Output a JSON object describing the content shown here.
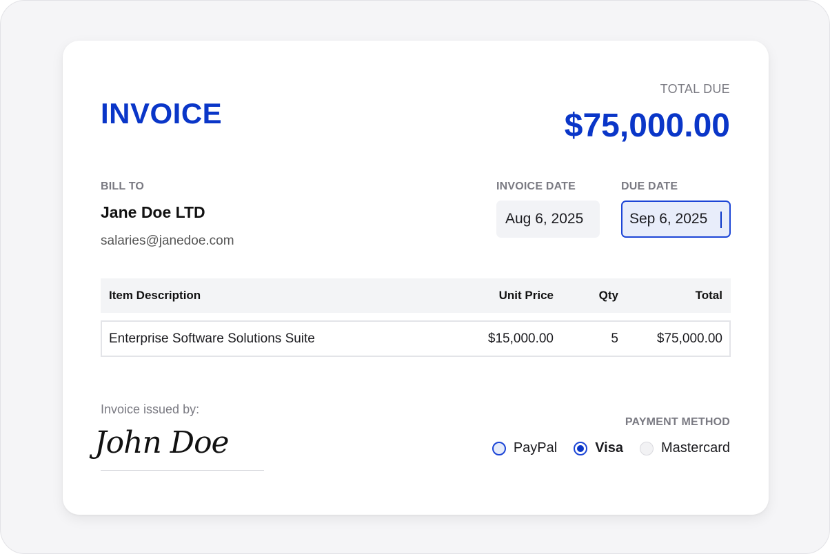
{
  "invoice": {
    "title": "INVOICE",
    "total_due_label": "TOTAL DUE",
    "total_due_amount": "$75,000.00"
  },
  "bill_to": {
    "label": "BILL TO",
    "name": "Jane Doe LTD",
    "email": "salaries@janedoe.com"
  },
  "dates": {
    "invoice_date_label": "INVOICE DATE",
    "invoice_date_value": "Aug 6, 2025",
    "due_date_label": "DUE DATE",
    "due_date_value": "Sep 6, 2025"
  },
  "table": {
    "headers": [
      "Item Description",
      "Unit Price",
      "Qty",
      "Total"
    ],
    "rows": [
      [
        "Enterprise Software Solutions Suite",
        "$15,000.00",
        "5",
        "$75,000.00"
      ]
    ]
  },
  "issued_by": {
    "label": "Invoice issued by:",
    "signature": "John Doe"
  },
  "payment": {
    "label": "PAYMENT METHOD",
    "options": [
      {
        "label": "PayPal",
        "state": "unselected"
      },
      {
        "label": "Visa",
        "state": "selected"
      },
      {
        "label": "Mastercard",
        "state": "disabled"
      }
    ]
  },
  "colors": {
    "accent": "#0a36c8",
    "muted": "#7a7a82",
    "border": "#e3e4e8"
  }
}
